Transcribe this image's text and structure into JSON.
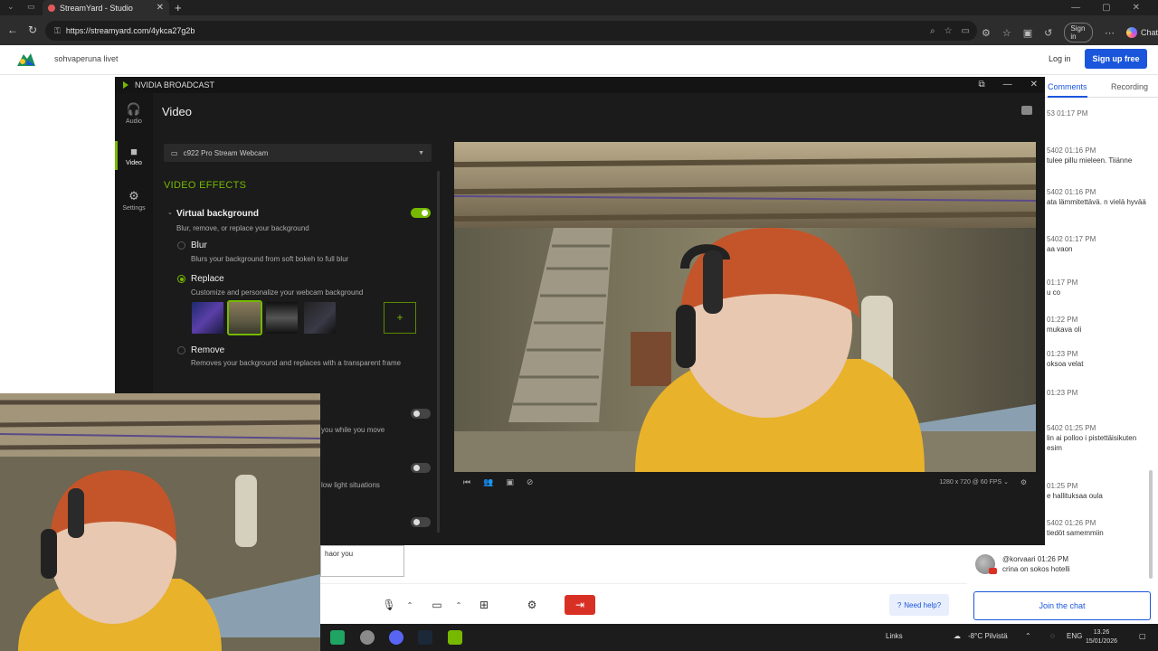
{
  "browser": {
    "tab_title": "StreamYard - Studio",
    "tab_close": "✕",
    "new_tab": "+",
    "url": "https://streamyard.com/4ykca27g2b",
    "sign_in": "Sign in",
    "chat": "Chat",
    "window_controls": [
      "—",
      "▢",
      "✕"
    ]
  },
  "streamyard": {
    "studio_name": "sohvaperuna livet",
    "login": "Log in",
    "signup": "Sign up free",
    "tabs": [
      "Comments",
      "Recording"
    ],
    "comments": [
      {
        "time": "53 01:17 PM",
        "text": ""
      },
      {
        "time": "5402 01:16 PM",
        "text": "tulee pillu mieleen. Tiiänne"
      },
      {
        "time": "5402 01:16 PM",
        "text": "ata lämmitettävä. n vielä hyvää"
      },
      {
        "time": "5402 01:17 PM",
        "text": "aa vaon"
      },
      {
        "time": "01:17 PM",
        "text": "u co"
      },
      {
        "time": "01:22 PM",
        "text": "mukava oli"
      },
      {
        "time": "01:23 PM",
        "text": "oksoa velat"
      },
      {
        "time": "01:23 PM",
        "text": ""
      },
      {
        "time": "5402 01:25 PM",
        "text": "lin ai polloo i pistettäisikuten esim"
      },
      {
        "time": "01:25 PM",
        "text": "e hallituksaa oula"
      },
      {
        "time": "5402 01:26 PM",
        "text": "tiedöt samemmiin"
      }
    ],
    "latest": {
      "user": "@korvaari",
      "time": "01:26 PM",
      "text": "crina on sokos hotelli"
    },
    "join_chat": "Join the chat",
    "need_help": "Need help?",
    "message_box": "haor you"
  },
  "nvidia": {
    "window_title": "NVIDIA BROADCAST",
    "rail": [
      {
        "label": "Audio",
        "icon": "headphones-icon"
      },
      {
        "label": "Video",
        "icon": "camera-icon"
      },
      {
        "label": "Settings",
        "icon": "gear-icon"
      }
    ],
    "page_title": "Video",
    "device": "c922 Pro Stream Webcam",
    "section": "VIDEO EFFECTS",
    "virtual_bg": {
      "title": "Virtual background",
      "desc": "Blur, remove, or replace your background",
      "enabled": true
    },
    "options": [
      {
        "label": "Blur",
        "desc": "Blurs your background from soft bokeh to full blur",
        "selected": false
      },
      {
        "label": "Replace",
        "desc": "Customize and personalize your webcam background",
        "selected": true
      },
      {
        "label": "Remove",
        "desc": "Removes your background and replaces with a transparent frame",
        "selected": false
      }
    ],
    "thumb_add": "+",
    "hidden_effects": [
      {
        "desc": "you while you move",
        "enabled": false
      },
      {
        "desc": "low light situations",
        "enabled": false
      },
      {
        "desc": "",
        "enabled": false
      }
    ],
    "preview_resolution": "1280 x 720 @ 60 FPS ⌄"
  },
  "taskbar": {
    "links": "Links",
    "weather": "-8°C Pilvistä",
    "lang": "ENG",
    "time": "13.26",
    "date": "15/01/2026"
  },
  "colors": {
    "nvidia_green": "#76b900",
    "streamyard_blue": "#1a56db",
    "leave_red": "#d93025"
  }
}
